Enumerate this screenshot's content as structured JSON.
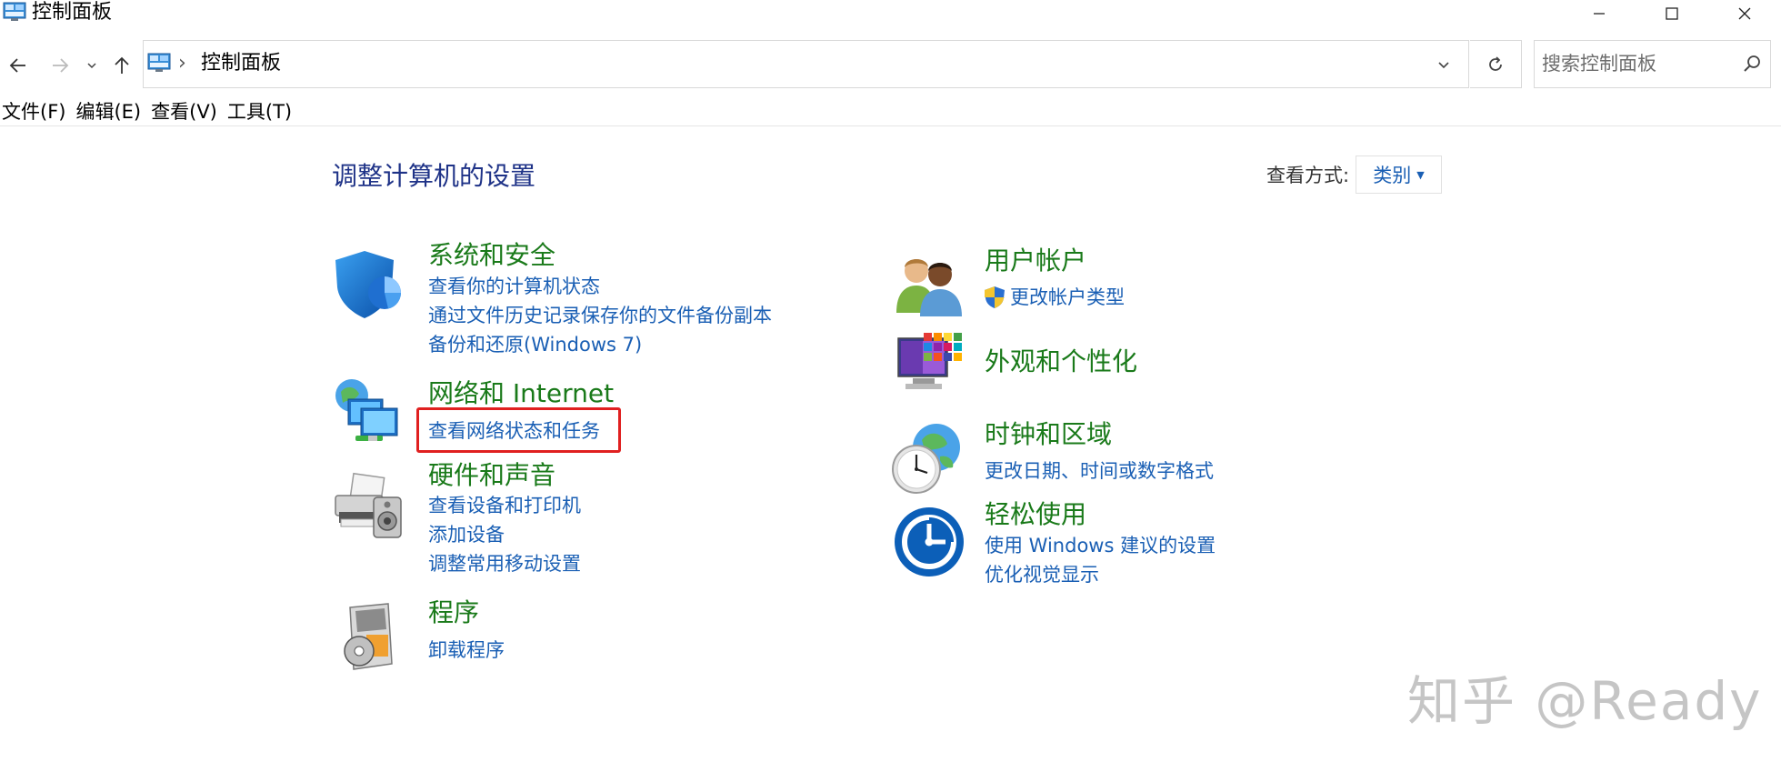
{
  "window": {
    "title": "控制面板"
  },
  "navigation": {
    "address": {
      "separator": "›",
      "path": "控制面板"
    },
    "search": {
      "placeholder": "搜索控制面板"
    }
  },
  "menu": {
    "items": [
      {
        "label": "文件(F)"
      },
      {
        "label": "编辑(E)"
      },
      {
        "label": "查看(V)"
      },
      {
        "label": "工具(T)"
      }
    ]
  },
  "main": {
    "title": "调整计算机的设置",
    "view_by": {
      "label": "查看方式:",
      "value": "类别"
    },
    "left_categories": [
      {
        "title": "系统和安全",
        "icon": "shield-icon",
        "links": [
          "查看你的计算机状态",
          "通过文件历史记录保存你的文件备份副本",
          "备份和还原(Windows 7)"
        ]
      },
      {
        "title": "网络和 Internet",
        "icon": "network-icon",
        "links": [
          "查看网络状态和任务"
        ]
      },
      {
        "title": "硬件和声音",
        "icon": "printer-icon",
        "links": [
          "查看设备和打印机",
          "添加设备",
          "调整常用移动设置"
        ]
      },
      {
        "title": "程序",
        "icon": "programs-icon",
        "links": [
          "卸载程序"
        ]
      }
    ],
    "right_categories": [
      {
        "title": "用户帐户",
        "icon": "users-icon",
        "links": [
          "更改帐户类型"
        ]
      },
      {
        "title": "外观和个性化",
        "icon": "appearance-icon",
        "links": []
      },
      {
        "title": "时钟和区域",
        "icon": "clock-globe-icon",
        "links": [
          "更改日期、时间或数字格式"
        ]
      },
      {
        "title": "轻松使用",
        "icon": "ease-of-access-icon",
        "links": [
          "使用 Windows 建议的设置",
          "优化视觉显示"
        ]
      }
    ]
  },
  "watermark": "知乎 @Ready",
  "colors": {
    "category_title": "#1a7a1a",
    "link": "#1a5fb4",
    "heading": "#1e3287",
    "highlight": "#e02020"
  }
}
